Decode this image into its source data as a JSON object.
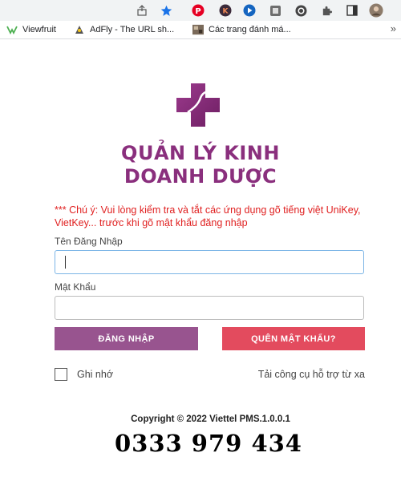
{
  "browser": {
    "toolbar_icons": [
      "share-icon",
      "star-icon",
      "pinterest-icon",
      "k-extension-icon",
      "screen-capture-icon",
      "extension-box-icon",
      "grammarly-icon",
      "puzzle-extensions-icon",
      "sidebar-icon",
      "profile-avatar-icon"
    ],
    "bookmarks": [
      {
        "label": "Viewfruit",
        "icon": "viewfruit-icon"
      },
      {
        "label": "AdFly - The URL sh...",
        "icon": "adfly-icon"
      },
      {
        "label": "Các trang đánh má...",
        "icon": "bookmark-thumbnail-icon"
      }
    ],
    "more_bookmarks": "»"
  },
  "app": {
    "title_line1": "QUẢN LÝ KINH",
    "title_line2": "DOANH DƯỢC",
    "brand_color": "#8a2f7d"
  },
  "form": {
    "warning": "*** Chú ý: Vui lòng kiểm tra và tắt các ứng dụng gõ tiếng việt UniKey, VietKey... trước khi gõ mật khẩu đăng nhập",
    "username_label": "Tên Đăng Nhập",
    "username_value": "",
    "password_label": "Mật Khẩu",
    "password_value": "",
    "login_button": "ĐĂNG NHẬP",
    "forgot_button": "QUÊN MẬT KHẨU?",
    "remember_label": "Ghi nhớ",
    "remember_checked": false,
    "download_tool_link": "Tải công cụ hỗ trợ từ xa"
  },
  "footer": {
    "copyright": "Copyright © 2022 Viettel PMS.1.0.0.1",
    "phone": "0333 979 434"
  },
  "colors": {
    "login_button": "#98548f",
    "forgot_button": "#e34b5e",
    "warning_text": "#e02020"
  }
}
